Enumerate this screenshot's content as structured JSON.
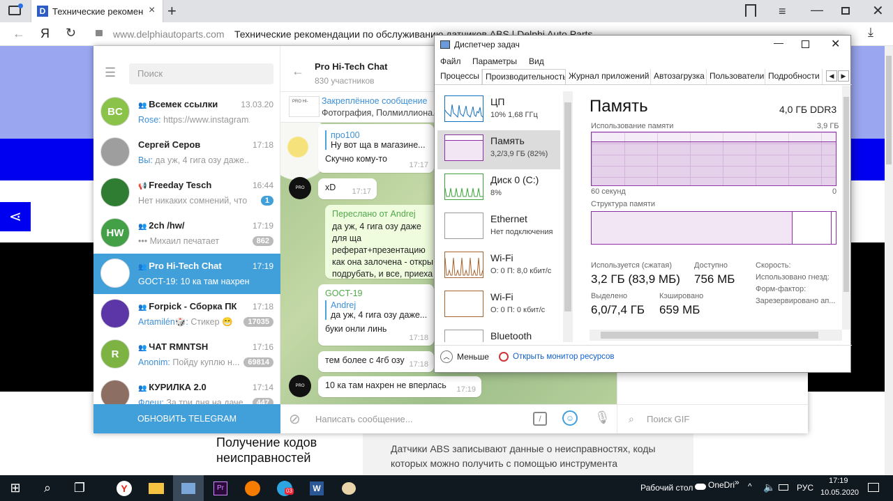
{
  "browser": {
    "tab_title": "Технические рекомендац",
    "tab_favicon": "D",
    "address_domain": "www.delphiautoparts.com",
    "address_title": "Технические рекомендации по обслуживанию датчиков ABS | Delphi Auto Parts",
    "yandex_button": "Я"
  },
  "webpage": {
    "section_heading": "Получение кодов неисправностей",
    "section_text": "Датчики ABS записывают данные о неисправностях, коды которых можно получить с помощью инструмента"
  },
  "telegram": {
    "search_placeholder": "Поиск",
    "update_button": "ОБНОВИТЬ TELEGRAM",
    "chats": [
      {
        "avatar_text": "BC",
        "avatar_color": "#8bc34a",
        "name": "Всемек ссылки",
        "time": "13.03.20",
        "sender": "Rose:",
        "preview": " https://www.instagram...",
        "badge": "",
        "type": "group"
      },
      {
        "avatar_text": "",
        "avatar_color": "#9e9e9e",
        "name": "Сергей Серов",
        "time": "17:18",
        "sender": "Вы:",
        "preview": " да уж, 4 гига озу даже...",
        "badge": "",
        "type": "user"
      },
      {
        "avatar_text": "",
        "avatar_color": "#2e7d32",
        "name": "Freeday Tesch",
        "time": "16:44",
        "sender": "",
        "preview": "Нет никаких сомнений, что ...",
        "badge": "1",
        "type": "channel"
      },
      {
        "avatar_text": "HW",
        "avatar_color": "#43a047",
        "name": "2ch /hw/",
        "time": "17:19",
        "sender": "",
        "preview": "••• Михаил печатает",
        "badge": "862",
        "type": "group"
      },
      {
        "avatar_text": "",
        "avatar_color": "#ffffff",
        "name": "Pro Hi-Tech Chat",
        "time": "17:19",
        "sender": "GOCT-19:",
        "preview": " 10 ка там нахрен не вп...",
        "badge": "",
        "type": "group"
      },
      {
        "avatar_text": "",
        "avatar_color": "#5c35a6",
        "name": "Forpick - Сборка ПК / ...",
        "time": "17:18",
        "sender": "Artamilén🎲:",
        "preview": " Стикер 😁",
        "badge": "17035",
        "type": "group"
      },
      {
        "avatar_text": "R",
        "avatar_color": "#7cb342",
        "name": "ЧАТ RMNTSH",
        "time": "17:16",
        "sender": "Anonim:",
        "preview": " Пойду куплю н...",
        "badge": "69814",
        "type": "group"
      },
      {
        "avatar_text": "",
        "avatar_color": "#8d6e63",
        "name": "КУРИЛКА 2.0",
        "time": "17:14",
        "sender": "Флеш:",
        "preview": " За три дня на даче...",
        "badge": "447",
        "type": "group"
      }
    ],
    "header": {
      "title": "Pro Hi-Tech Chat",
      "subtitle": "830 участников",
      "pinned_label": "Закреплённое сообщение",
      "pinned_text": "Фотография, Полмиллиона..."
    },
    "messages": [
      {
        "sender": "про100",
        "text": "Ну вот ща в магазине...",
        "body": "Скучно кому-то",
        "time": "17:17"
      },
      {
        "text": "xD",
        "time": "17:17"
      },
      {
        "forward": "Переслано от Andrej",
        "text": "да уж, 4 гига озу даже для ща реферат+презентацию как она залочена - откры подрубать, и все, приеха"
      },
      {
        "sender": "GOCT-19",
        "quote_name": "Andrej",
        "quote_text": "да уж, 4 гига озу даже...",
        "body": "буки онли линь",
        "time": "17:18"
      },
      {
        "text": "тем более с 4гб озу",
        "time": "17:18"
      },
      {
        "text": "10 ка там нахрен не вперлась",
        "time": "17:19"
      }
    ],
    "compose_placeholder": "Написать сообщение...",
    "gif_search_placeholder": "Поиск GIF"
  },
  "taskmgr": {
    "title": "Диспетчер задач",
    "menu": [
      "Файл",
      "Параметры",
      "Вид"
    ],
    "tabs": [
      "Процессы",
      "Производительность",
      "Журнал приложений",
      "Автозагрузка",
      "Пользователи",
      "Подробности"
    ],
    "resources": [
      {
        "name": "ЦП",
        "detail": "10%  1,68 ГГц",
        "color": "#1170c0"
      },
      {
        "name": "Память",
        "detail": "3,2/3,9 ГБ (82%)",
        "color": "#8b2ea6"
      },
      {
        "name": "Диск 0 (C:)",
        "detail": "8%",
        "color": "#3ba53b"
      },
      {
        "name": "Ethernet",
        "detail": "Нет подключения",
        "color": "#999999"
      },
      {
        "name": "Wi-Fi",
        "detail": "О: 0  П: 8,0 кбит/с",
        "color": "#a8612a"
      },
      {
        "name": "Wi-Fi",
        "detail": "О: 0  П: 0 кбит/с",
        "color": "#a8612a"
      },
      {
        "name": "Bluetooth",
        "detail": "",
        "color": "#999999"
      }
    ],
    "memory": {
      "title": "Память",
      "total": "4,0 ГБ DDR3",
      "usage_label": "Использование памяти",
      "usage_max": "3,9 ГБ",
      "time_left": "60 секунд",
      "time_right": "0",
      "structure_label": "Структура памяти",
      "in_use_label": "Используется (сжатая)",
      "in_use_value": "3,2 ГБ (83,9 МБ)",
      "available_label": "Доступно",
      "available_value": "756 МБ",
      "committed_label": "Выделено",
      "committed_value": "6,0/7,4 ГБ",
      "cached_label": "Кэшировано",
      "cached_value": "659 МБ",
      "speed_label": "Скорость:",
      "slots_label": "Использовано гнезд:",
      "form_label": "Форм-фактор:",
      "reserved_label": "Зарезервировано ап..."
    },
    "less_button": "Меньше",
    "monitor_link": "Открыть монитор ресурсов"
  },
  "taskbar": {
    "desktop_label": "Рабочий стол",
    "onedrive_label": "OneDri",
    "lang": "РУС",
    "time": "17:19",
    "date": "10.05.2020",
    "telegram_badge": "03"
  }
}
